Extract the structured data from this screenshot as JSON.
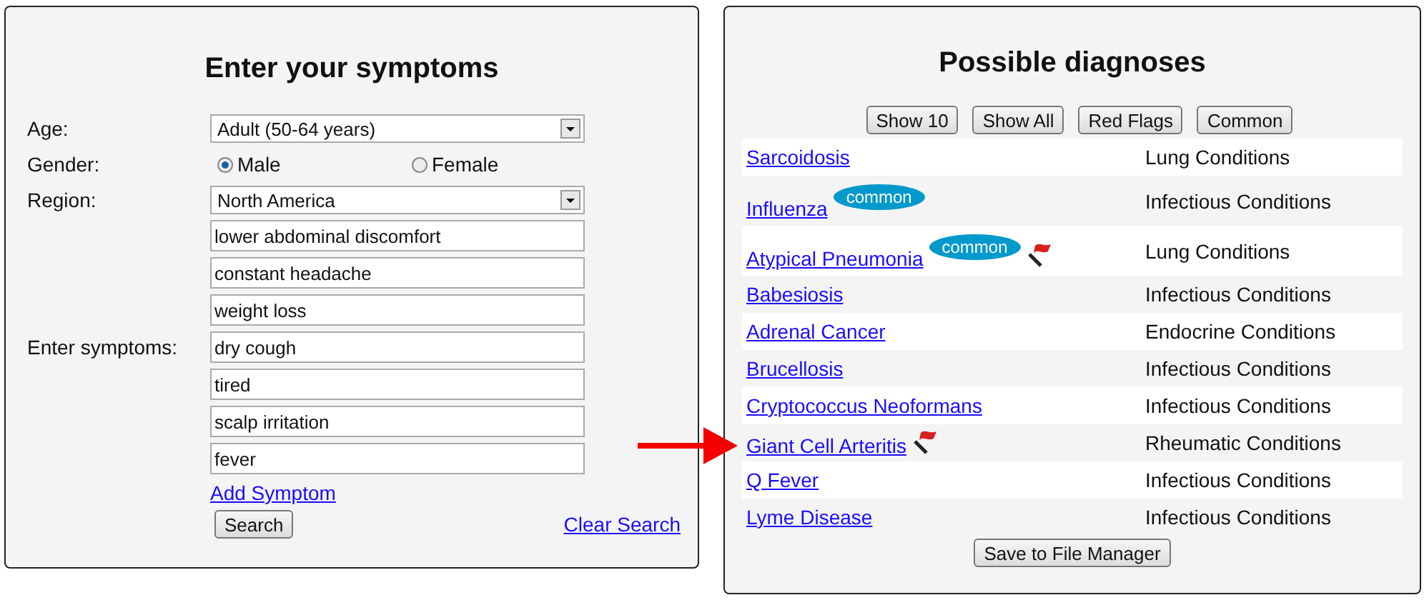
{
  "symptoms_form": {
    "title": "Enter your symptoms",
    "age": {
      "label": "Age:",
      "value": "Adult (50-64 years)"
    },
    "gender": {
      "label": "Gender:",
      "options": [
        {
          "label": "Male",
          "selected": true
        },
        {
          "label": "Female",
          "selected": false
        }
      ]
    },
    "region": {
      "label": "Region:",
      "value": "North America"
    },
    "symptoms_label": "Enter symptoms:",
    "symptoms": [
      "lower abdominal discomfort",
      "constant headache",
      "weight loss",
      "dry cough",
      "tired",
      "scalp irritation",
      "fever"
    ],
    "add_link": "Add Symptom",
    "search_button": "Search",
    "clear_link": "Clear Search"
  },
  "diagnoses": {
    "title": "Possible diagnoses",
    "filters": [
      "Show 10",
      "Show All",
      "Red Flags",
      "Common"
    ],
    "rows": [
      {
        "name": "Sarcoidosis",
        "badge": null,
        "red_flag": false,
        "category": "Lung Conditions",
        "pointed": false
      },
      {
        "name": "Influenza",
        "badge": "common",
        "red_flag": false,
        "category": "Infectious Conditions",
        "pointed": false
      },
      {
        "name": "Atypical Pneumonia",
        "badge": "common",
        "red_flag": true,
        "category": "Lung Conditions",
        "pointed": false
      },
      {
        "name": "Babesiosis",
        "badge": null,
        "red_flag": false,
        "category": "Infectious Conditions",
        "pointed": false
      },
      {
        "name": "Adrenal Cancer",
        "badge": null,
        "red_flag": false,
        "category": "Endocrine Conditions",
        "pointed": false
      },
      {
        "name": "Brucellosis",
        "badge": null,
        "red_flag": false,
        "category": "Infectious Conditions",
        "pointed": false
      },
      {
        "name": "Cryptococcus Neoformans",
        "badge": null,
        "red_flag": false,
        "category": "Infectious Conditions",
        "pointed": false
      },
      {
        "name": "Giant Cell Arteritis",
        "badge": null,
        "red_flag": true,
        "category": "Rheumatic Conditions",
        "pointed": true
      },
      {
        "name": "Q Fever",
        "badge": null,
        "red_flag": false,
        "category": "Infectious Conditions",
        "pointed": false
      },
      {
        "name": "Lyme Disease",
        "badge": null,
        "red_flag": false,
        "category": "Infectious Conditions",
        "pointed": false
      }
    ],
    "save_button": "Save to File Manager"
  }
}
